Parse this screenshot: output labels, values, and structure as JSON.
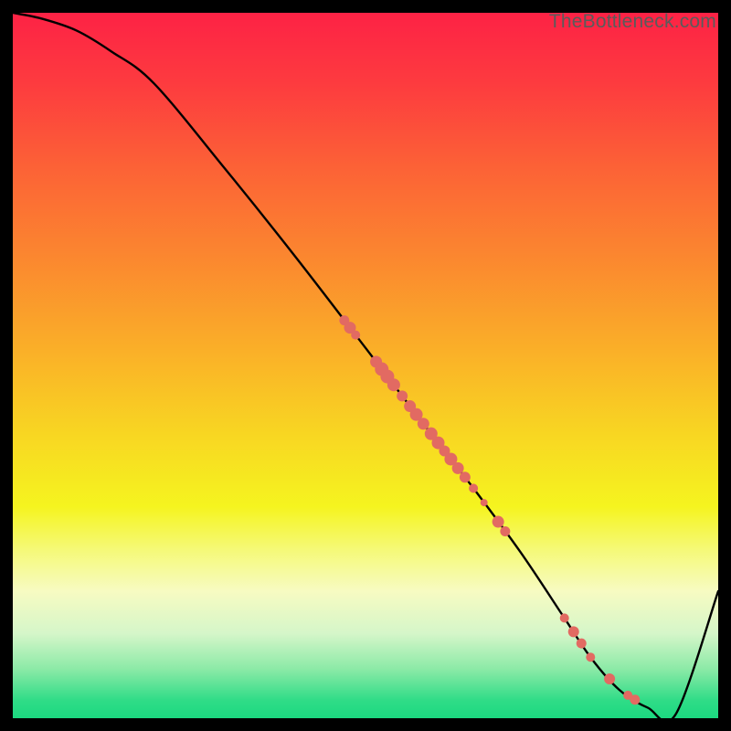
{
  "watermark": "TheBottleneck.com",
  "colors": {
    "bg": "#000000",
    "gradient_stops": [
      {
        "offset": 0.0,
        "color": "#fd2245"
      },
      {
        "offset": 0.1,
        "color": "#fd3b3f"
      },
      {
        "offset": 0.22,
        "color": "#fc6236"
      },
      {
        "offset": 0.35,
        "color": "#fb882f"
      },
      {
        "offset": 0.48,
        "color": "#fab028"
      },
      {
        "offset": 0.6,
        "color": "#f8d722"
      },
      {
        "offset": 0.7,
        "color": "#f5f41f"
      },
      {
        "offset": 0.76,
        "color": "#f5f976"
      },
      {
        "offset": 0.82,
        "color": "#f7fbc2"
      },
      {
        "offset": 0.88,
        "color": "#d5f6c9"
      },
      {
        "offset": 0.93,
        "color": "#8ceaa7"
      },
      {
        "offset": 0.975,
        "color": "#2fdc87"
      },
      {
        "offset": 1.0,
        "color": "#1cd980"
      }
    ],
    "curve": "#000000",
    "dot": "#e26a62"
  },
  "chart_data": {
    "type": "line",
    "title": "",
    "xlabel": "",
    "ylabel": "",
    "xlim": [
      0,
      100
    ],
    "ylim": [
      0,
      100
    ],
    "series": [
      {
        "name": "curve",
        "x": [
          0,
          4,
          9,
          14,
          20,
          30,
          40,
          50,
          58,
          65,
          72,
          78,
          82,
          86,
          90,
          94,
          100
        ],
        "y": [
          100,
          99.2,
          97.5,
          94.5,
          90,
          78,
          65.5,
          52.5,
          42,
          33,
          23.5,
          14.5,
          8.5,
          4,
          1.5,
          0.6,
          18
        ]
      }
    ],
    "dots": [
      {
        "x": 47.0,
        "r": 5.5
      },
      {
        "x": 47.8,
        "r": 6.5
      },
      {
        "x": 48.6,
        "r": 5.0
      },
      {
        "x": 51.5,
        "r": 6.5
      },
      {
        "x": 52.3,
        "r": 7.5
      },
      {
        "x": 53.1,
        "r": 7.5
      },
      {
        "x": 54.0,
        "r": 7.0
      },
      {
        "x": 55.2,
        "r": 6.0
      },
      {
        "x": 56.3,
        "r": 6.5
      },
      {
        "x": 57.2,
        "r": 7.0
      },
      {
        "x": 58.2,
        "r": 6.5
      },
      {
        "x": 59.3,
        "r": 7.0
      },
      {
        "x": 60.3,
        "r": 7.0
      },
      {
        "x": 61.2,
        "r": 6.0
      },
      {
        "x": 62.1,
        "r": 7.0
      },
      {
        "x": 63.1,
        "r": 6.5
      },
      {
        "x": 64.1,
        "r": 6.0
      },
      {
        "x": 65.3,
        "r": 5.0
      },
      {
        "x": 66.8,
        "r": 4.0
      },
      {
        "x": 68.8,
        "r": 6.5
      },
      {
        "x": 69.8,
        "r": 5.5
      },
      {
        "x": 78.2,
        "r": 5.0
      },
      {
        "x": 79.5,
        "r": 6.0
      },
      {
        "x": 80.6,
        "r": 5.5
      },
      {
        "x": 81.9,
        "r": 5.0
      },
      {
        "x": 84.6,
        "r": 6.0
      },
      {
        "x": 87.2,
        "r": 5.0
      },
      {
        "x": 88.2,
        "r": 5.5
      }
    ]
  }
}
